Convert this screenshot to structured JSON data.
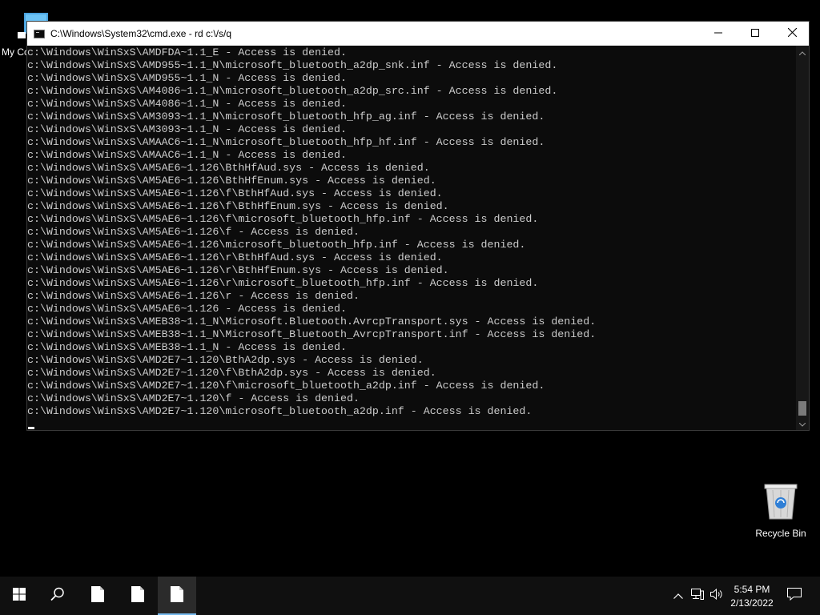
{
  "desktop": {
    "icons": [
      {
        "label": "My Cc",
        "icon": "computer-icon"
      },
      {
        "label": "Recycle Bin",
        "icon": "recycle-bin-icon"
      }
    ]
  },
  "window": {
    "title": "C:\\Windows\\System32\\cmd.exe - rd  c:\\/s/q",
    "icon": "console-icon",
    "buttons": {
      "minimize": "minimize-icon",
      "maximize": "maximize-icon",
      "close": "close-icon"
    }
  },
  "console": {
    "lines": [
      "c:\\Windows\\WinSxS\\AMDFDA~1.1_E - Access is denied.",
      "c:\\Windows\\WinSxS\\AMD955~1.1_N\\microsoft_bluetooth_a2dp_snk.inf - Access is denied.",
      "c:\\Windows\\WinSxS\\AMD955~1.1_N - Access is denied.",
      "c:\\Windows\\WinSxS\\AM4086~1.1_N\\microsoft_bluetooth_a2dp_src.inf - Access is denied.",
      "c:\\Windows\\WinSxS\\AM4086~1.1_N - Access is denied.",
      "c:\\Windows\\WinSxS\\AM3093~1.1_N\\microsoft_bluetooth_hfp_ag.inf - Access is denied.",
      "c:\\Windows\\WinSxS\\AM3093~1.1_N - Access is denied.",
      "c:\\Windows\\WinSxS\\AMAAC6~1.1_N\\microsoft_bluetooth_hfp_hf.inf - Access is denied.",
      "c:\\Windows\\WinSxS\\AMAAC6~1.1_N - Access is denied.",
      "c:\\Windows\\WinSxS\\AM5AE6~1.126\\BthHfAud.sys - Access is denied.",
      "c:\\Windows\\WinSxS\\AM5AE6~1.126\\BthHfEnum.sys - Access is denied.",
      "c:\\Windows\\WinSxS\\AM5AE6~1.126\\f\\BthHfAud.sys - Access is denied.",
      "c:\\Windows\\WinSxS\\AM5AE6~1.126\\f\\BthHfEnum.sys - Access is denied.",
      "c:\\Windows\\WinSxS\\AM5AE6~1.126\\f\\microsoft_bluetooth_hfp.inf - Access is denied.",
      "c:\\Windows\\WinSxS\\AM5AE6~1.126\\f - Access is denied.",
      "c:\\Windows\\WinSxS\\AM5AE6~1.126\\microsoft_bluetooth_hfp.inf - Access is denied.",
      "c:\\Windows\\WinSxS\\AM5AE6~1.126\\r\\BthHfAud.sys - Access is denied.",
      "c:\\Windows\\WinSxS\\AM5AE6~1.126\\r\\BthHfEnum.sys - Access is denied.",
      "c:\\Windows\\WinSxS\\AM5AE6~1.126\\r\\microsoft_bluetooth_hfp.inf - Access is denied.",
      "c:\\Windows\\WinSxS\\AM5AE6~1.126\\r - Access is denied.",
      "c:\\Windows\\WinSxS\\AM5AE6~1.126 - Access is denied.",
      "c:\\Windows\\WinSxS\\AMEB38~1.1_N\\Microsoft.Bluetooth.AvrcpTransport.sys - Access is denied.",
      "c:\\Windows\\WinSxS\\AMEB38~1.1_N\\Microsoft_Bluetooth_AvrcpTransport.inf - Access is denied.",
      "c:\\Windows\\WinSxS\\AMEB38~1.1_N - Access is denied.",
      "c:\\Windows\\WinSxS\\AMD2E7~1.120\\BthA2dp.sys - Access is denied.",
      "c:\\Windows\\WinSxS\\AMD2E7~1.120\\f\\BthA2dp.sys - Access is denied.",
      "c:\\Windows\\WinSxS\\AMD2E7~1.120\\f\\microsoft_bluetooth_a2dp.inf - Access is denied.",
      "c:\\Windows\\WinSxS\\AMD2E7~1.120\\f - Access is denied.",
      "c:\\Windows\\WinSxS\\AMD2E7~1.120\\microsoft_bluetooth_a2dp.inf - Access is denied."
    ],
    "text_color": "#cccccc",
    "background": "#0c0c0c"
  },
  "taskbar": {
    "start": "windows-start-icon",
    "search": "search-icon",
    "apps": [
      "file-icon",
      "file-icon",
      "file-icon"
    ],
    "active_app_index": 2,
    "accent": "#76b9ed",
    "tray": {
      "icons": [
        "chevron-up-icon",
        "network-icon",
        "volume-icon",
        "notification-icon"
      ],
      "time": "5:54 PM",
      "date": "2/13/2022"
    }
  }
}
